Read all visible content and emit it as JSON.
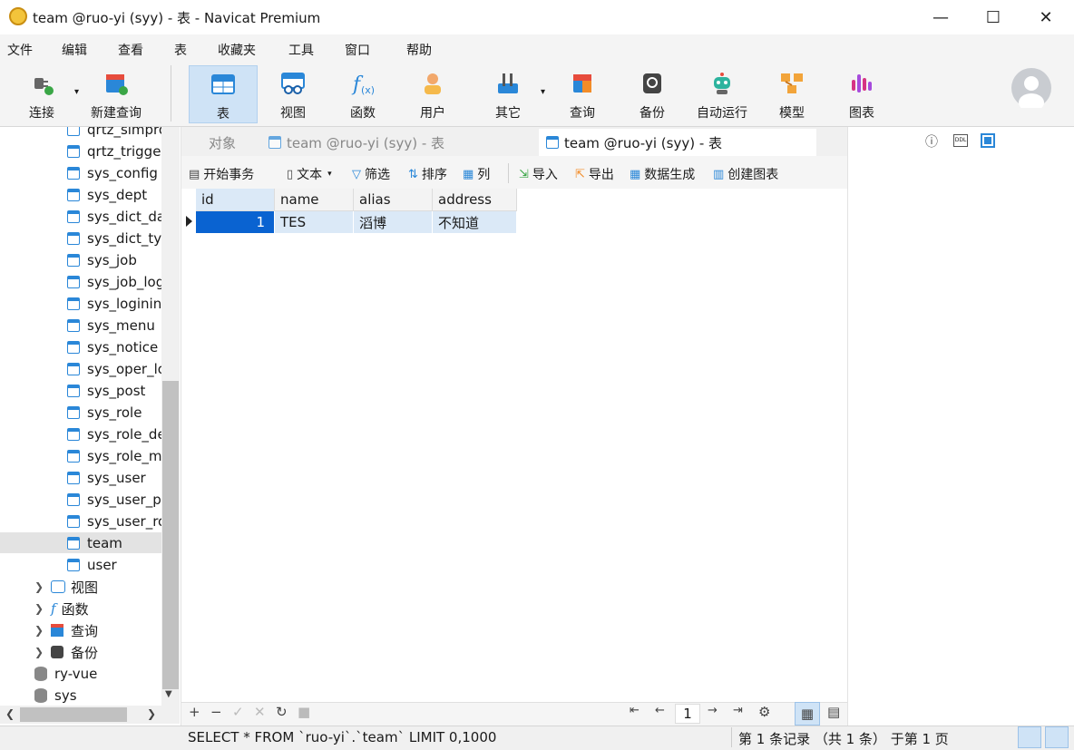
{
  "window": {
    "title": "team @ruo-yi (syy) - 表 - Navicat Premium",
    "minimize": "—",
    "maximize": "☐",
    "close": "✕"
  },
  "menu": [
    "文件",
    "编辑",
    "查看",
    "表",
    "收藏夹",
    "工具",
    "窗口",
    "帮助"
  ],
  "toolbar": {
    "items": [
      {
        "label": "连接",
        "icon": "plug-icon"
      },
      {
        "label": "新建查询",
        "icon": "new-query-icon"
      },
      {
        "label": "表",
        "icon": "table-icon"
      },
      {
        "label": "视图",
        "icon": "view-icon"
      },
      {
        "label": "函数",
        "icon": "function-icon"
      },
      {
        "label": "用户",
        "icon": "user-icon"
      },
      {
        "label": "其它",
        "icon": "tools-icon"
      },
      {
        "label": "查询",
        "icon": "query-icon"
      },
      {
        "label": "备份",
        "icon": "backup-icon"
      },
      {
        "label": "自动运行",
        "icon": "robot-icon"
      },
      {
        "label": "模型",
        "icon": "model-icon"
      },
      {
        "label": "图表",
        "icon": "chart-icon"
      }
    ],
    "active": "表"
  },
  "sidebar": {
    "tables": [
      "qrtz_simpro",
      "qrtz_trigge",
      "sys_config",
      "sys_dept",
      "sys_dict_da",
      "sys_dict_typ",
      "sys_job",
      "sys_job_log",
      "sys_loginint",
      "sys_menu",
      "sys_notice",
      "sys_oper_lo",
      "sys_post",
      "sys_role",
      "sys_role_de",
      "sys_role_me",
      "sys_user",
      "sys_user_po",
      "sys_user_ro",
      "team",
      "user"
    ],
    "selected": "team",
    "groups": [
      "视图",
      "函数",
      "查询",
      "备份"
    ],
    "databases": [
      "ry-vue",
      "sys"
    ]
  },
  "tabs": {
    "objects": "对象",
    "inactive": "team @ruo-yi (syy) - 表",
    "active": "team @ruo-yi (syy) - 表"
  },
  "subtoolbar": {
    "begin_tx": "开始事务",
    "text": "文本",
    "filter": "筛选",
    "sort": "排序",
    "columns": "列",
    "import": "导入",
    "export": "导出",
    "generate": "数据生成",
    "create_chart": "创建图表"
  },
  "grid": {
    "columns": [
      "id",
      "name",
      "alias",
      "address"
    ],
    "rows": [
      [
        "1",
        "TES",
        "滔博",
        "不知道"
      ]
    ]
  },
  "pager": {
    "page": "1"
  },
  "status": {
    "sql": "SELECT * FROM `ruo-yi`.`team` LIMIT 0,1000",
    "records": "第 1 条记录 （共 1 条） 于第 1 页"
  }
}
